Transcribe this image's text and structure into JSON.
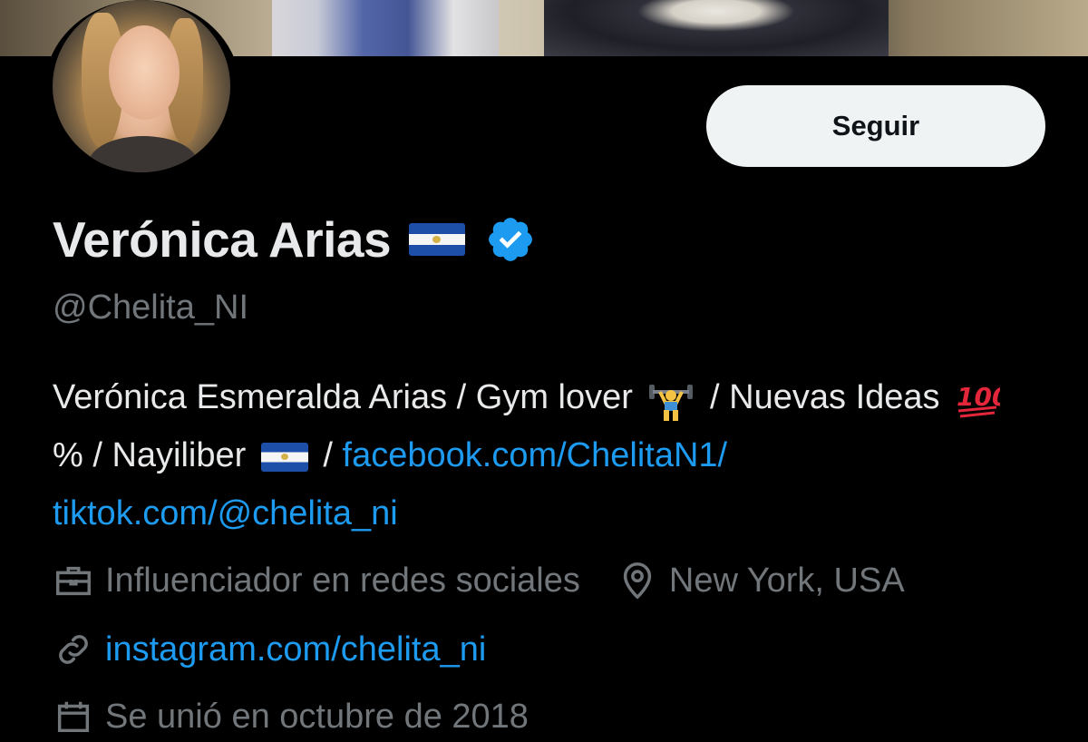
{
  "profile": {
    "name": "Verónica Arias",
    "handle": "@Chelita_NI",
    "follow_label": "Seguir",
    "bio": {
      "part1": "Verónica Esmeralda Arias / Gym lover",
      "part2": "/ Nuevas Ideas",
      "part3": "% / Nayiliber",
      "part4": "/",
      "link1": "facebook.com/ChelitaN1/",
      "link2": "tiktok.com/@chelita_ni"
    },
    "category": "Influenciador en redes sociales",
    "location": "New York, USA",
    "website": "instagram.com/chelita_ni",
    "joined": "Se unió en octubre de 2018"
  },
  "icons": {
    "verified": "verified-badge-icon",
    "flag": "el-salvador-flag-icon",
    "gym": "weight-lifter-emoji",
    "hundred": "hundred-points-emoji",
    "category": "briefcase-icon",
    "location": "location-pin-icon",
    "link": "link-icon",
    "calendar": "calendar-icon"
  },
  "colors": {
    "background": "#000000",
    "text": "#e7e9ea",
    "muted": "#71767b",
    "link": "#1d9bf0",
    "button_bg": "#eff3f4",
    "button_text": "#0f1419"
  }
}
